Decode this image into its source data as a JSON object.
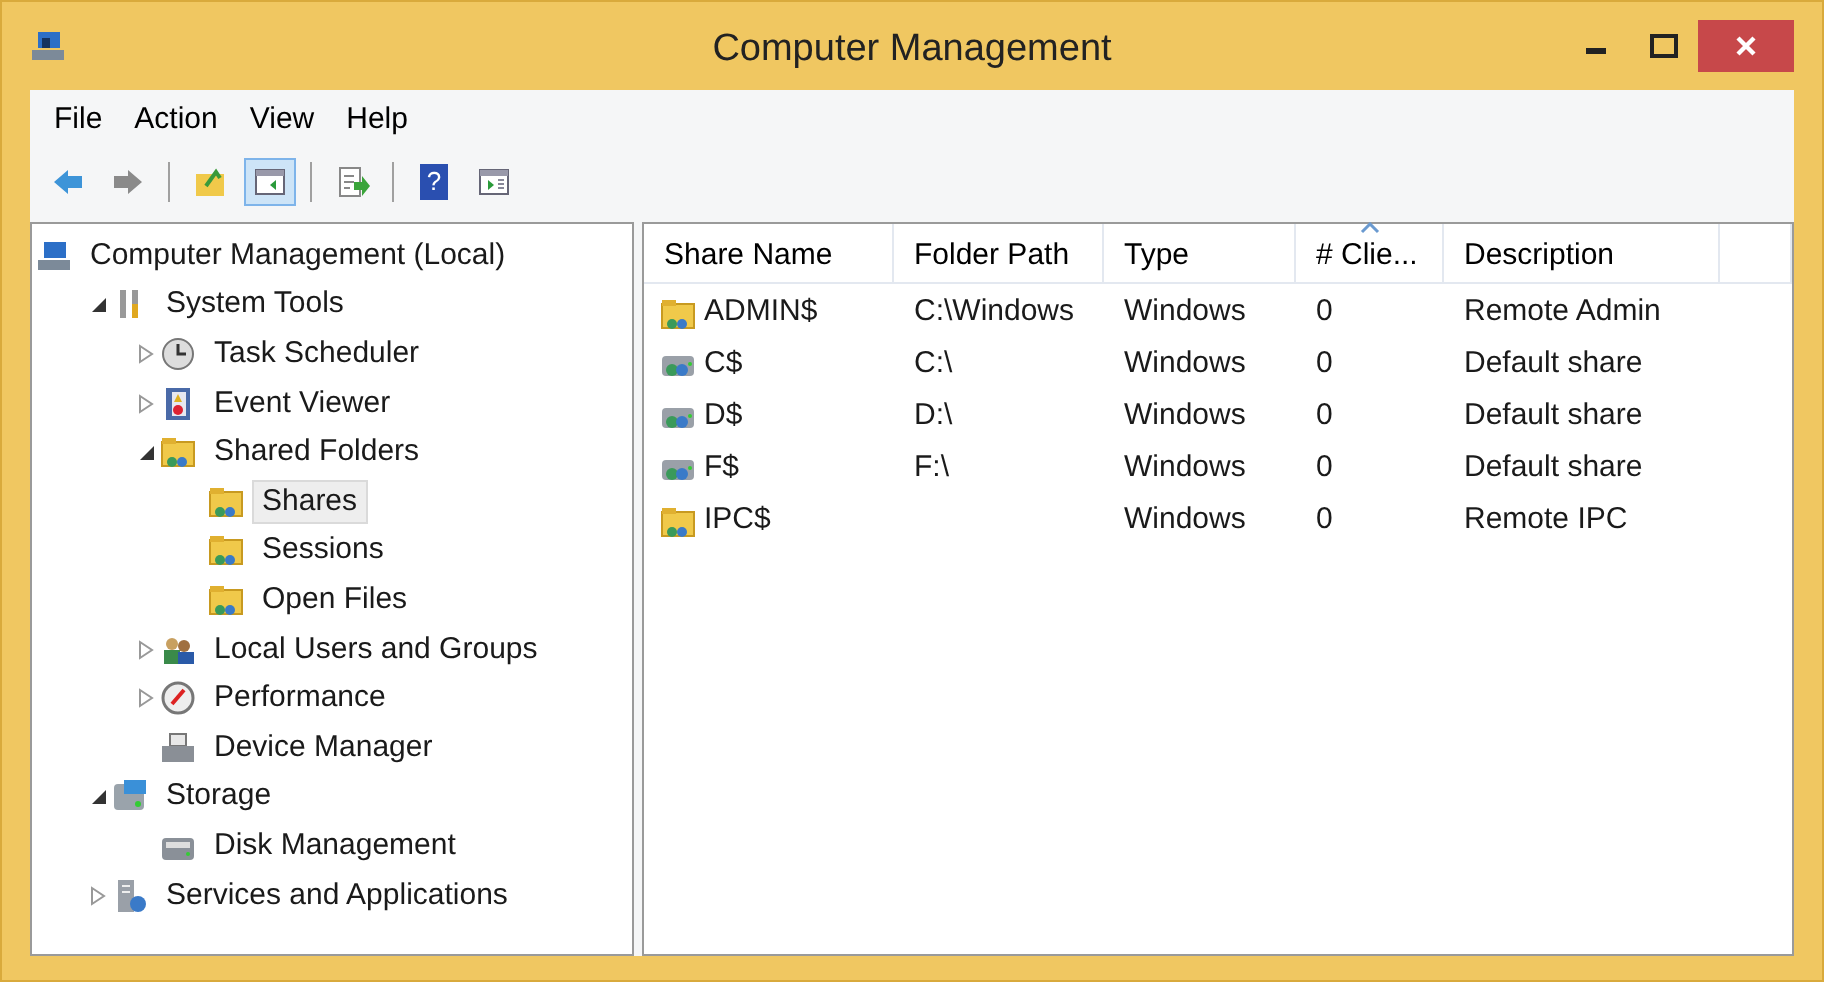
{
  "window": {
    "title": "Computer Management"
  },
  "menu": [
    "File",
    "Action",
    "View",
    "Help"
  ],
  "toolbar": [
    {
      "kind": "back",
      "pressed": false
    },
    {
      "kind": "forward",
      "pressed": false
    },
    {
      "kind": "separator"
    },
    {
      "kind": "up",
      "pressed": false
    },
    {
      "kind": "pane",
      "pressed": true
    },
    {
      "kind": "separator"
    },
    {
      "kind": "export",
      "pressed": false
    },
    {
      "kind": "separator"
    },
    {
      "kind": "help",
      "pressed": false,
      "symbol": "?"
    },
    {
      "kind": "action-pane",
      "pressed": false
    }
  ],
  "tree": [
    {
      "label": "Computer Management (Local)",
      "kind": "computer",
      "selected": false,
      "children": [
        {
          "label": "System Tools",
          "kind": "tools",
          "expanded": true,
          "selected": false,
          "children": [
            {
              "label": "Task Scheduler",
              "kind": "clock",
              "expanded": false,
              "selected": false
            },
            {
              "label": "Event Viewer",
              "kind": "event",
              "expanded": false,
              "selected": false
            },
            {
              "label": "Shared Folders",
              "kind": "share",
              "expanded": true,
              "selected": false,
              "children": [
                {
                  "label": "Shares",
                  "kind": "share",
                  "selected": true
                },
                {
                  "label": "Sessions",
                  "kind": "share",
                  "selected": false
                },
                {
                  "label": "Open Files",
                  "kind": "share",
                  "selected": false
                }
              ]
            },
            {
              "label": "Local Users and Groups",
              "kind": "users",
              "expanded": false,
              "selected": false
            },
            {
              "label": "Performance",
              "kind": "gauge",
              "expanded": false,
              "selected": false
            },
            {
              "label": "Device Manager",
              "kind": "device",
              "selected": false
            }
          ]
        },
        {
          "label": "Storage",
          "kind": "storage",
          "expanded": true,
          "selected": false,
          "children": [
            {
              "label": "Disk Management",
              "kind": "disk",
              "selected": false
            }
          ]
        },
        {
          "label": "Services and Applications",
          "kind": "services",
          "expanded": false,
          "selected": false
        }
      ]
    }
  ],
  "table": {
    "columns": [
      {
        "label": "Share Name",
        "sorted": false
      },
      {
        "label": "Folder Path",
        "sorted": false
      },
      {
        "label": "Type",
        "sorted": false
      },
      {
        "label": "# Clie...",
        "sorted": true
      },
      {
        "label": "Description",
        "sorted": false
      }
    ],
    "rows": [
      {
        "kind": "folder",
        "cells": [
          "ADMIN$",
          "C:\\Windows",
          "Windows",
          "0",
          "Remote Admin"
        ]
      },
      {
        "kind": "drive",
        "cells": [
          "C$",
          "C:\\",
          "Windows",
          "0",
          "Default share"
        ]
      },
      {
        "kind": "drive",
        "cells": [
          "D$",
          "D:\\",
          "Windows",
          "0",
          "Default share"
        ]
      },
      {
        "kind": "drive",
        "cells": [
          "F$",
          "F:\\",
          "Windows",
          "0",
          "Default share"
        ]
      },
      {
        "kind": "folder",
        "cells": [
          "IPC$",
          "",
          "Windows",
          "0",
          "Remote IPC"
        ]
      }
    ]
  }
}
